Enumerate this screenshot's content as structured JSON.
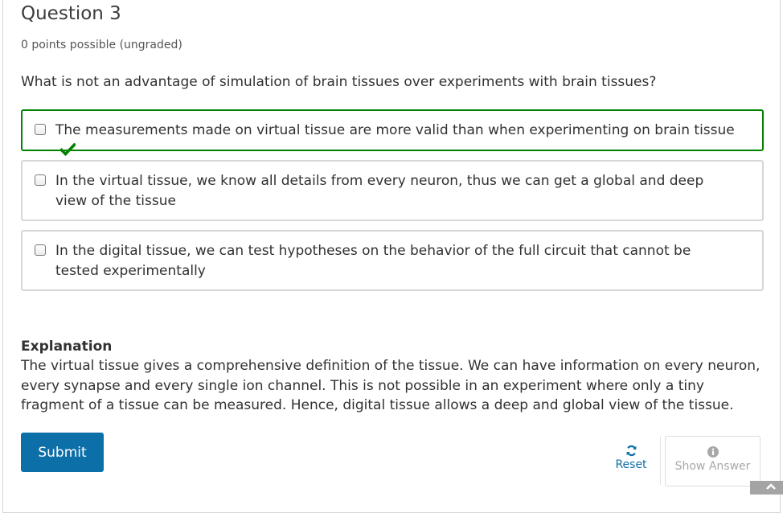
{
  "question": {
    "title": "Question 3",
    "points": "0 points possible (ungraded)",
    "prompt": "What is not an advantage of simulation of brain tissues over experiments with brain tissues?"
  },
  "choices": [
    {
      "label": "The measurements made on virtual tissue are more valid than when experimenting on brain tissue",
      "checked": false,
      "marked_correct": true
    },
    {
      "label": "In the virtual tissue, we know all details from every neuron, thus we can get a global and deep view of the tissue",
      "checked": false,
      "marked_correct": false
    },
    {
      "label": "In the digital tissue, we can test hypotheses on the behavior of the full circuit that cannot be tested experimentally",
      "checked": false,
      "marked_correct": false
    }
  ],
  "explanation": {
    "title": "Explanation",
    "body": "The virtual tissue gives a comprehensive definition of the tissue. We can have information on every neuron, every synapse and every single ion channel. This is not possible in an experiment where only a tiny fragment of a tissue can be measured. Hence, digital tissue allows a deep and global view of the tissue."
  },
  "actions": {
    "submit_label": "Submit",
    "reset_label": "Reset",
    "show_answer_label": "Show Answer"
  },
  "icons": {
    "correct": "checkmark-icon",
    "reset": "refresh-icon",
    "show_answer": "info-circle-icon",
    "scroll": "arrow-up-icon"
  },
  "colors": {
    "accent": "#0d6fa8",
    "correct_border": "#008100",
    "correct_check": "#008100",
    "disabled_text": "#a8a8a8"
  }
}
